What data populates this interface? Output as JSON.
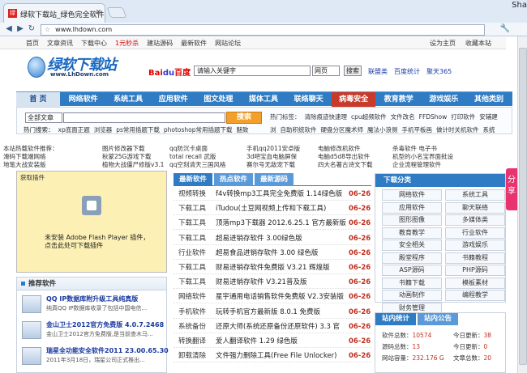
{
  "browser": {
    "tab_title": "绿软下载站_绿色完全软件...",
    "tab_close": "×",
    "window_label": "Sha",
    "url": "www.lhdown.com",
    "nav_icons": {
      "back": "◀",
      "forward": "▶",
      "reload": "↻",
      "star": "☆",
      "tools": "🔧"
    }
  },
  "site_top": {
    "links": [
      "首页",
      "文章资讯",
      "下载中心",
      "1元秒杀",
      "建站源码",
      "最新软件",
      "网站论坛"
    ],
    "right_links": [
      "设为主页",
      "收藏本站"
    ]
  },
  "logo": {
    "title": "绿软下载站",
    "subtitle": "www.LhDown.com"
  },
  "baidu": {
    "brand_a": "Bai",
    "brand_b": "du",
    "brand_c": "百度",
    "query": "请输入关键字",
    "scope": "网页",
    "button": "搜索"
  },
  "top_links": [
    "联盟类",
    "百度统计",
    "聚天365"
  ],
  "main_nav": [
    {
      "label": "首 页",
      "style": "on"
    },
    {
      "label": "网络软件",
      "style": ""
    },
    {
      "label": "系统工具",
      "style": ""
    },
    {
      "label": "应用软件",
      "style": ""
    },
    {
      "label": "图文处理",
      "style": ""
    },
    {
      "label": "媒体工具",
      "style": ""
    },
    {
      "label": "联络聊天",
      "style": ""
    },
    {
      "label": "病毒安全",
      "style": "red"
    },
    {
      "label": "教育教学",
      "style": ""
    },
    {
      "label": "游戏娱乐",
      "style": ""
    },
    {
      "label": "其他类别",
      "style": ""
    }
  ],
  "search": {
    "scope": "全部文章",
    "button": "搜索",
    "hot_label": "热门搜索：",
    "hot_keywords": [
      "xp底面正题",
      "浏览器",
      "ps常用插题下载",
      "photoshop常用插题下载",
      "魅致"
    ],
    "tags_label": "热门标签：",
    "tags": [
      "清除痕迹快速理",
      "cpu超频软件",
      "文件改名",
      "FFDShow",
      "打印软件",
      "安辅建"
    ],
    "tags2": [
      "浏",
      "自助积统软件",
      "硬盘分区魔术师",
      "魔法小浪侧",
      "手机平板画",
      "做计时关机软件",
      "系统"
    ]
  },
  "rec_grid": [
    [
      "本站热载软件推荐：",
      "图片修改器下载",
      "qq防沉卡桌面",
      "手机qq2011安卓版",
      "电脑修改机软件",
      "杀毒软件 电子书"
    ],
    [
      "滑码下载端网络",
      "秋蒙25G游戏下载",
      "total recall 武版",
      "3d吧宝血电脑屏保",
      "电脑d5d8导出软件",
      "机型的小名宝界面批设"
    ],
    [
      "地笔大战安装版",
      "植物大战僵尸修版v3.1",
      "qq空刻清天三国风格",
      "赛尔号无敌宠下载",
      "四大名著古诗文下载",
      "企业流程管理软件"
    ]
  ],
  "flash": {
    "header": "获取插件",
    "line1": "未安装 Adobe Flash Player 插件，",
    "line2": "点击此处可下载插件"
  },
  "recommend": {
    "header": "推荐软件",
    "items": [
      {
        "title": "QQ IP数据库附升级工具纯真版",
        "desc": "纯真QQ IP数据库收录了包括中国电信..."
      },
      {
        "title": "金山卫士2012官方免费版 4.0.7.2468",
        "desc": "金山卫士2012官方免费版,是当前查木马..."
      },
      {
        "title": "瑞星全功能安全软件2011 23.00.65.30",
        "desc": "2011年3月18日，瑞星公司正式推出..."
      }
    ]
  },
  "tabs": [
    "最新软件",
    "热点软件",
    "最新源码"
  ],
  "list": [
    {
      "cat": "视频转换",
      "title": "f4v转换mp3工具完全免费版 1.14绿色版",
      "date": "06-26"
    },
    {
      "cat": "下载工具",
      "title": "iTudou(土豆网视频上传和下载工具)",
      "date": "06-26"
    },
    {
      "cat": "下载工具",
      "title": "顶落mp3下载器 2012.6.25.1 官方最新版",
      "date": "06-26"
    },
    {
      "cat": "下载工具",
      "title": "超易进销存软件 3.00绿色版",
      "date": "06-26"
    },
    {
      "cat": "行业软件",
      "title": "超易食品进销存软件 3.00 绿色版",
      "date": "06-26"
    },
    {
      "cat": "下载工具",
      "title": "财易进销存软件免费版 V3.21 辉煌版",
      "date": "06-26"
    },
    {
      "cat": "下载工具",
      "title": "财易进销存软件 V3.21普及版",
      "date": "06-26"
    },
    {
      "cat": "网络软件",
      "title": "星宇通用电话销售软件免费版 V2.3安装版",
      "date": "06-26"
    },
    {
      "cat": "手机软件",
      "title": "玩转手机官方最新版 8.0.1 免费版",
      "date": "06-26"
    },
    {
      "cat": "系统备份",
      "title": "还原大师(系统还原备份还原软件) 3.3 官",
      "date": "06-26"
    },
    {
      "cat": "转换翻译",
      "title": "爱人翻译软件 1.29 绿色版",
      "date": "06-26"
    },
    {
      "cat": "卸载清除",
      "title": "文件强力删除工具(Free File Unlocker)",
      "date": "06-26"
    }
  ],
  "categories": {
    "header": "下载分类",
    "items": [
      "网络软件",
      "系统工具",
      "应用软件",
      "聊天联络",
      "图形图像",
      "多媒体类",
      "教育教学",
      "行业软件",
      "安全相关",
      "游戏娱乐",
      "殿堂程序",
      "书籍教程",
      "ASP源码",
      "PHP源码",
      "书籍下载",
      "模板素材",
      "动画制作",
      "编程教学",
      "财务管理"
    ]
  },
  "stats": {
    "tabs": [
      "站内统计",
      "站内公告"
    ],
    "rows": [
      {
        "l": "软件总数：",
        "lv": "10574",
        "r": "今日更新：",
        "rv": "38"
      },
      {
        "l": "源码总数：",
        "lv": "13",
        "r": "今日更新：",
        "rv": "0"
      },
      {
        "l": "网站容量：",
        "lv": "232.176 G",
        "r": "文章总数：",
        "rv": "20"
      }
    ]
  },
  "share": "分享"
}
